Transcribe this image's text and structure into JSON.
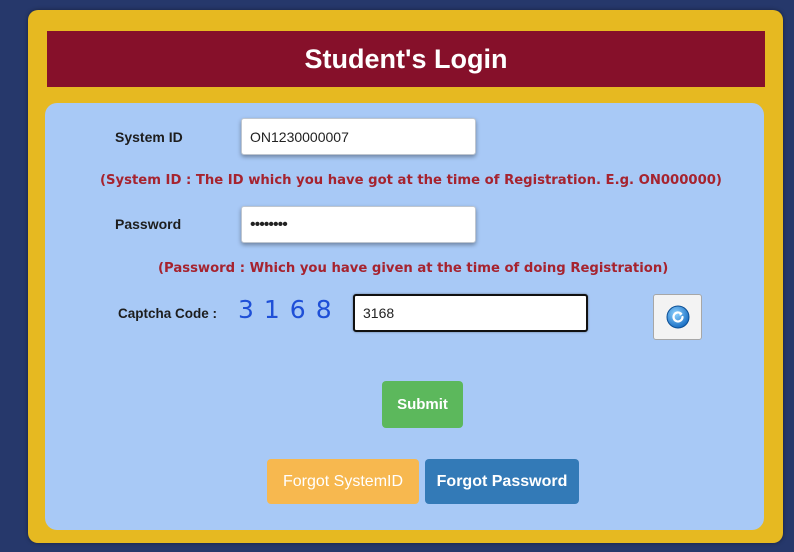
{
  "header": {
    "title": "Student's Login"
  },
  "form": {
    "system_id": {
      "label": "System ID",
      "value": "ON1230000007",
      "hint": "(System ID : The ID which you have got at the time of Registration. E.g. ON000000)"
    },
    "password": {
      "label": "Password",
      "value": "••••••••",
      "hint": "(Password : Which you have given at the time of doing Registration)"
    },
    "captcha": {
      "label": "Captcha Code :",
      "code": "3168",
      "value": "3168"
    }
  },
  "buttons": {
    "submit": "Submit",
    "forgot_systemid": "Forgot SystemID",
    "forgot_password": "Forgot Password"
  },
  "colors": {
    "page_bg": "#26386b",
    "frame": "#e6b921",
    "header_bg": "#86102a",
    "panel_bg": "#a8c9f6",
    "hint_text": "#a6232f",
    "captcha_text": "#1e4fd7",
    "submit": "#5cb85c",
    "forgot_systemid": "#f7b84f",
    "forgot_password": "#337ab7"
  },
  "icons": {
    "refresh": "refresh-icon"
  }
}
